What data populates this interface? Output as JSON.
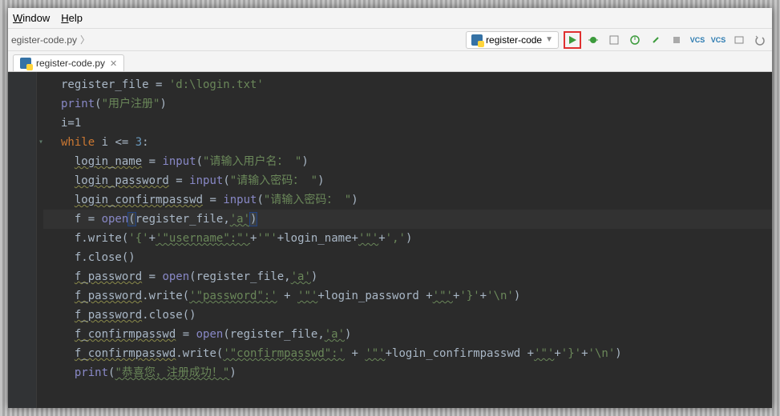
{
  "menu": {
    "window": "Window",
    "help": "Help"
  },
  "breadcrumb": {
    "file": "egister-code.py"
  },
  "run_config": {
    "name": "register-code"
  },
  "tab": {
    "name": "register-code.py"
  },
  "code": {
    "l1a": "register_file = ",
    "l1b": "'d:\\login.txt'",
    "l2a": "print",
    "l2b": "(",
    "l2c": "\"用户注册\"",
    "l2d": ")",
    "l3": "i=1",
    "l4a": "while",
    "l4b": " i <= ",
    "l4c": "3",
    "l4d": ":",
    "l5a": "login_name",
    "l5b": " = ",
    "l5c": "input",
    "l5d": "(",
    "l5e": "\"请输入用户名： \"",
    "l5f": ")",
    "l6a": "login_password",
    "l6b": " = ",
    "l6c": "input",
    "l6d": "(",
    "l6e": "\"请输入密码： \"",
    "l6f": ")",
    "l7a": "login_confirmpasswd",
    "l7b": " = ",
    "l7c": "input",
    "l7d": "(",
    "l7e": "\"请输入密码： \"",
    "l7f": ")",
    "l8a": "f = ",
    "l8b": "open",
    "l8c": "(",
    "l8d": "register_file",
    "l8e": ",",
    "l8f": "'a'",
    "l8g": ")",
    "l9a": "f.write(",
    "l9b": "'{'",
    "l9c": "+",
    "l9d": "'\"username\":\"'",
    "l9e": "+",
    "l9f": "'\"'",
    "l9g": "+login_name+",
    "l9h": "'\"'",
    "l9i": "+",
    "l9j": "','",
    "l9k": ")",
    "l10": "f.close()",
    "l11a": "f_password",
    "l11b": " = ",
    "l11c": "open",
    "l11d": "(register_file,",
    "l11e": "'a'",
    "l11f": ")",
    "l12a": "f_password",
    "l12b": ".write(",
    "l12c": "'\"password\":'",
    "l12d": " + ",
    "l12e": "'\"'",
    "l12f": "+login_password +",
    "l12g": "'\"'",
    "l12h": "+",
    "l12i": "'}'",
    "l12j": "+",
    "l12k": "'\\n'",
    "l12l": ")",
    "l13a": "f_password",
    "l13b": ".close()",
    "l14a": "f_confirmpasswd",
    "l14b": " = ",
    "l14c": "open",
    "l14d": "(register_file,",
    "l14e": "'a'",
    "l14f": ")",
    "l15a": "f_confirmpasswd",
    "l15b": ".write(",
    "l15c": "'\"confirmpasswd\":'",
    "l15d": " + ",
    "l15e": "'\"'",
    "l15f": "+login_confirmpasswd +",
    "l15g": "'\"'",
    "l15h": "+",
    "l15i": "'}'",
    "l15j": "+",
    "l15k": "'\\n'",
    "l15l": ")",
    "l16a": "print",
    "l16b": "(",
    "l16c": "\"恭喜您，注册成功！\"",
    "l16d": ")"
  }
}
